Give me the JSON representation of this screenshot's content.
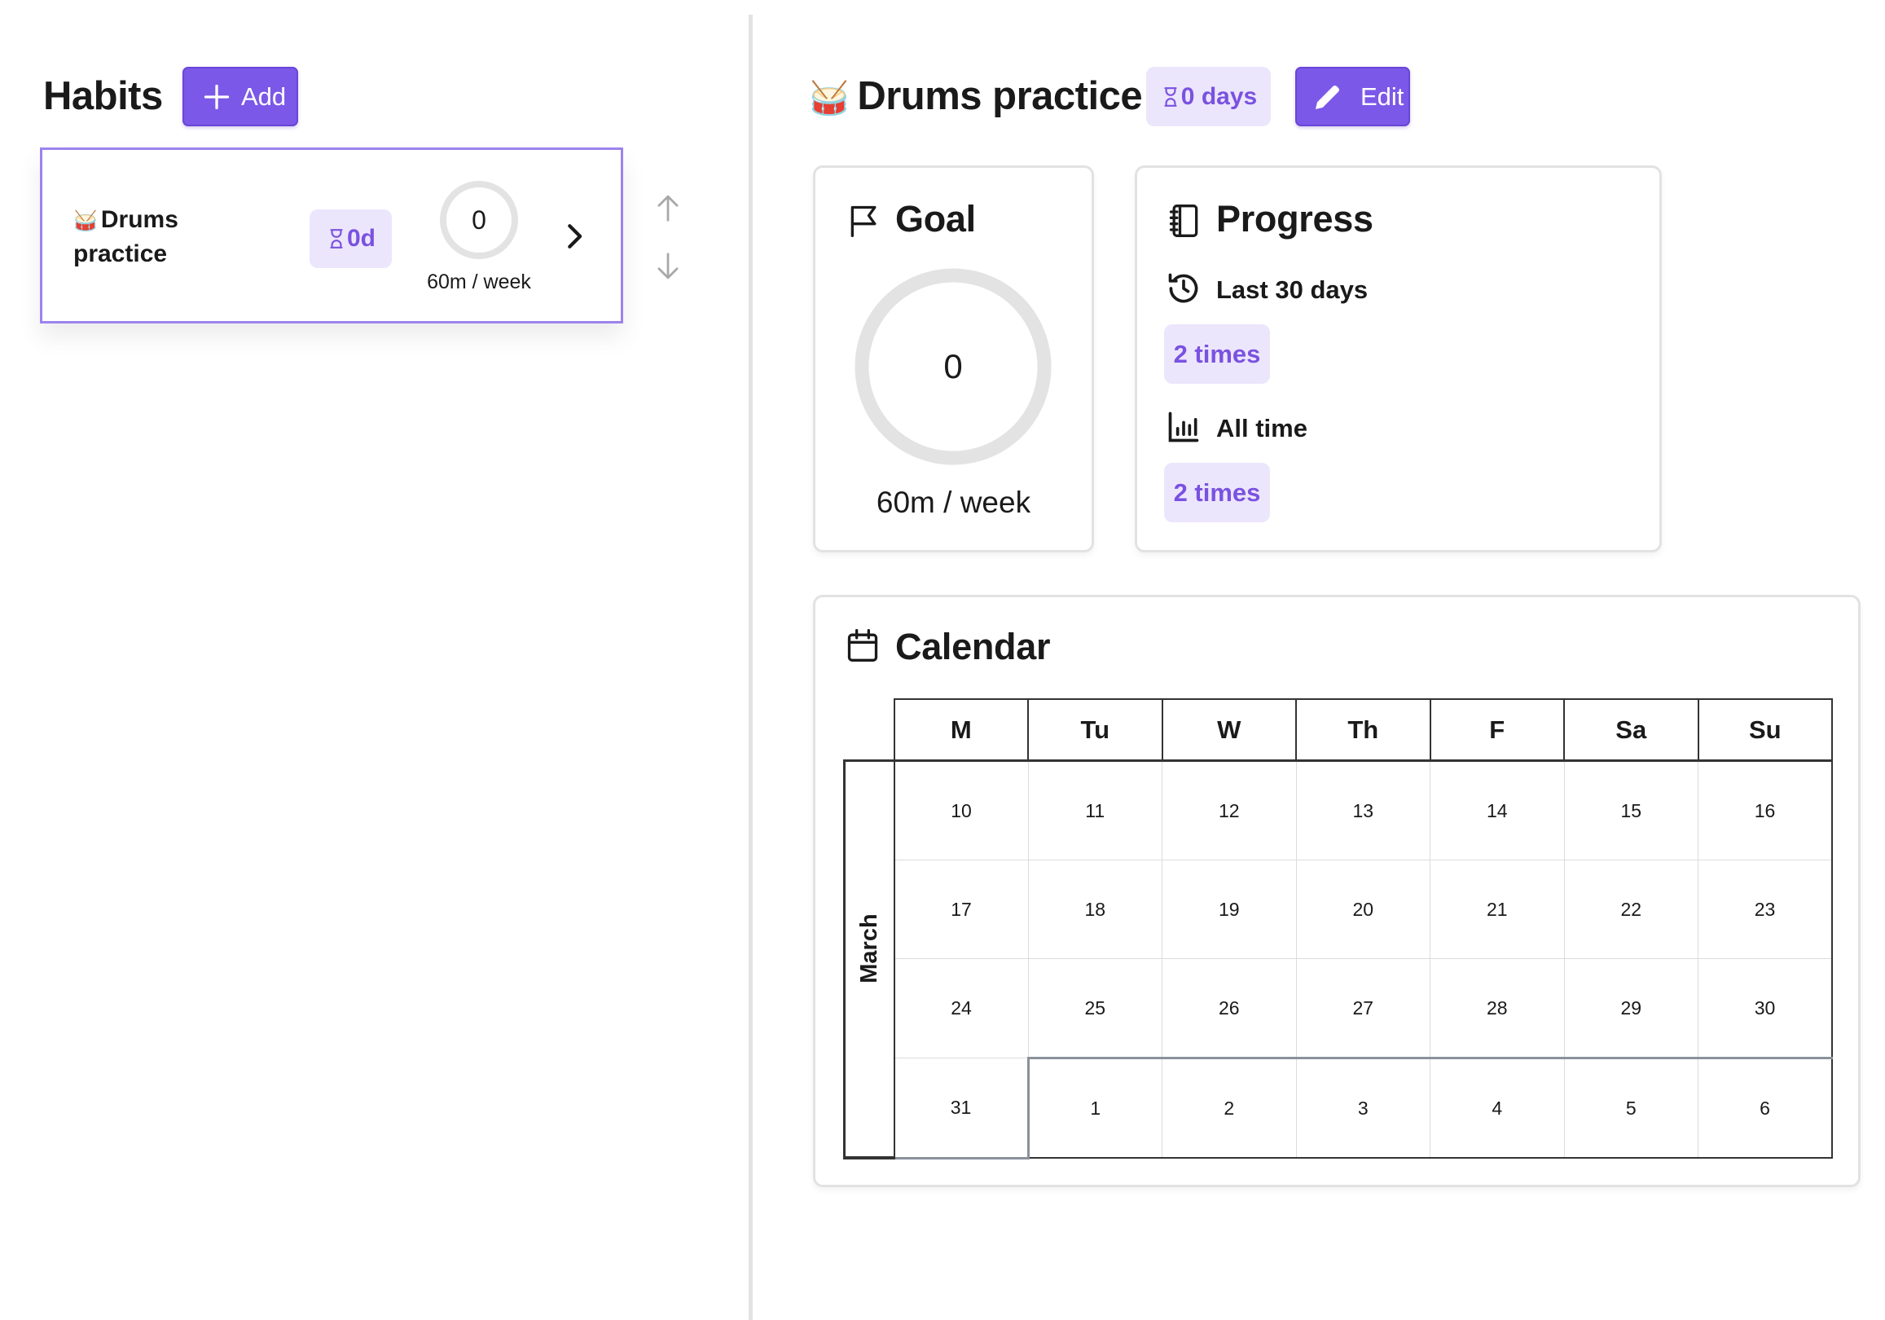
{
  "habits_list": {
    "title": "Habits",
    "add_label": "Add",
    "items": [
      {
        "emoji": "🥁",
        "name": "Drums practice",
        "streak_badge": "0d",
        "progress_value": "0",
        "goal_text": "60m / week"
      }
    ]
  },
  "detail": {
    "emoji": "🥁",
    "title": "Drums practice",
    "streak_badge": "0 days",
    "edit_label": "Edit",
    "goal": {
      "title": "Goal",
      "value": "0",
      "progress_fraction": 0,
      "text": "60m / week"
    },
    "progress": {
      "title": "Progress",
      "last30_label": "Last 30 days",
      "last30_value": "2 times",
      "alltime_label": "All time",
      "alltime_value": "2 times"
    },
    "calendar": {
      "title": "Calendar",
      "weekdays": [
        "M",
        "Tu",
        "W",
        "Th",
        "F",
        "Sa",
        "Su"
      ],
      "month": "March",
      "weeks": [
        [
          "10",
          "11",
          "12",
          "13",
          "14",
          "15",
          "16"
        ],
        [
          "17",
          "18",
          "19",
          "20",
          "21",
          "22",
          "23"
        ],
        [
          "24",
          "25",
          "26",
          "27",
          "28",
          "29",
          "30"
        ],
        [
          "31",
          "1",
          "2",
          "3",
          "4",
          "5",
          "6"
        ]
      ]
    }
  },
  "colors": {
    "accent": "#7c58e8",
    "badge_bg": "#ece6fc",
    "badge_text": "#7a52e0",
    "ring": "#e3e3e3"
  }
}
